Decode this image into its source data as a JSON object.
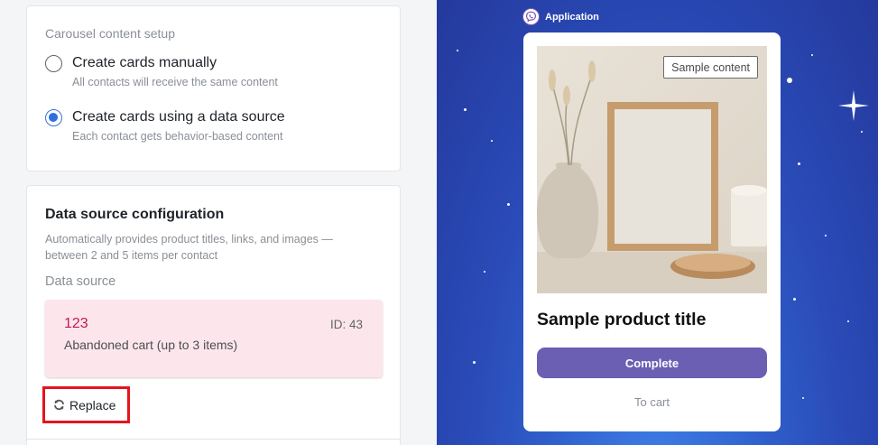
{
  "carousel_setup": {
    "title": "Carousel content setup",
    "options": [
      {
        "label": "Create cards manually",
        "description": "All contacts will receive the same content",
        "selected": false
      },
      {
        "label": "Create cards using a data source",
        "description": "Each contact gets behavior-based content",
        "selected": true
      }
    ]
  },
  "data_source_config": {
    "title": "Data source configuration",
    "description": "Automatically provides product titles, links, and images — between 2 and 5 items per contact",
    "source_label": "Data source",
    "source": {
      "name": "123",
      "id": "ID: 43",
      "type": "Abandoned cart (up to 3 items)"
    },
    "replace_label": "Replace"
  },
  "preview": {
    "app_name": "Application",
    "sample_badge": "Sample content",
    "product_title": "Sample product title",
    "primary_button": "Complete",
    "secondary_link": "To cart"
  },
  "colors": {
    "accent_radio": "#2f6fe0",
    "source_bg": "#fde6eb",
    "source_name": "#c2185b",
    "highlight_border": "#e5141c",
    "button_purple": "#6a5fb3",
    "preview_bg": "#2f5fcb"
  },
  "icons": {
    "replace": "refresh-icon",
    "app_logo": "viber-logo-icon"
  }
}
